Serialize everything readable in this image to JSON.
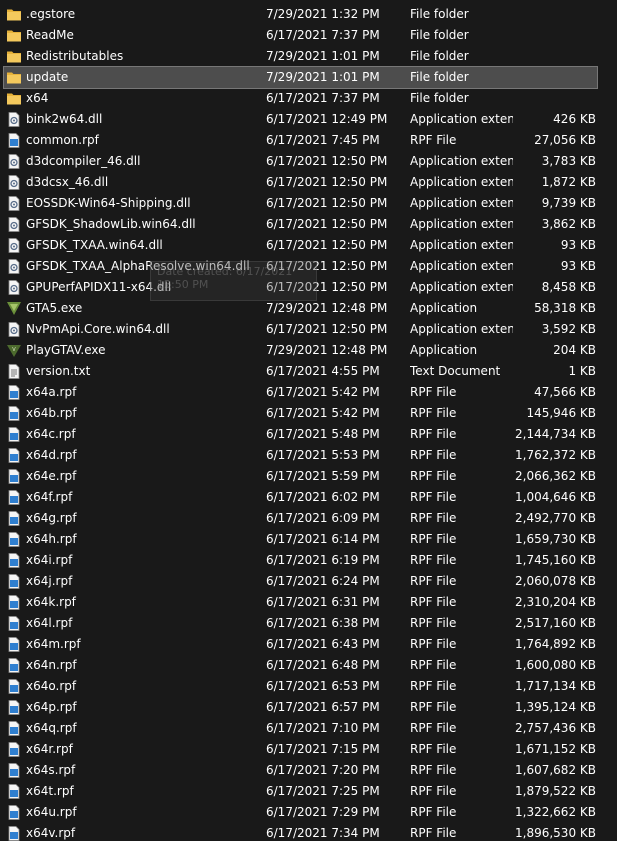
{
  "explorer": {
    "selected_index": 3,
    "files": [
      {
        "name": ".egstore",
        "date": "7/29/2021 1:32 PM",
        "type": "File folder",
        "size": "",
        "icon": "folder-icon"
      },
      {
        "name": "ReadMe",
        "date": "6/17/2021 7:37 PM",
        "type": "File folder",
        "size": "",
        "icon": "folder-icon"
      },
      {
        "name": "Redistributables",
        "date": "7/29/2021 1:01 PM",
        "type": "File folder",
        "size": "",
        "icon": "folder-icon"
      },
      {
        "name": "update",
        "date": "7/29/2021 1:01 PM",
        "type": "File folder",
        "size": "",
        "icon": "folder-icon"
      },
      {
        "name": "x64",
        "date": "6/17/2021 7:37 PM",
        "type": "File folder",
        "size": "",
        "icon": "folder-icon"
      },
      {
        "name": "bink2w64.dll",
        "date": "6/17/2021 12:49 PM",
        "type": "Application exten...",
        "size": "426 KB",
        "icon": "dll-icon"
      },
      {
        "name": "common.rpf",
        "date": "6/17/2021 7:45 PM",
        "type": "RPF File",
        "size": "27,056 KB",
        "icon": "rpf-icon"
      },
      {
        "name": "d3dcompiler_46.dll",
        "date": "6/17/2021 12:50 PM",
        "type": "Application exten...",
        "size": "3,783 KB",
        "icon": "dll-icon"
      },
      {
        "name": "d3dcsx_46.dll",
        "date": "6/17/2021 12:50 PM",
        "type": "Application exten...",
        "size": "1,872 KB",
        "icon": "dll-icon"
      },
      {
        "name": "EOSSDK-Win64-Shipping.dll",
        "date": "6/17/2021 12:50 PM",
        "type": "Application exten...",
        "size": "9,739 KB",
        "icon": "dll-icon"
      },
      {
        "name": "GFSDK_ShadowLib.win64.dll",
        "date": "6/17/2021 12:50 PM",
        "type": "Application exten...",
        "size": "3,862 KB",
        "icon": "dll-icon"
      },
      {
        "name": "GFSDK_TXAA.win64.dll",
        "date": "6/17/2021 12:50 PM",
        "type": "Application exten...",
        "size": "93 KB",
        "icon": "dll-icon"
      },
      {
        "name": "GFSDK_TXAA_AlphaResolve.win64.dll",
        "date": "6/17/2021 12:50 PM",
        "type": "Application exten...",
        "size": "93 KB",
        "icon": "dll-icon"
      },
      {
        "name": "GPUPerfAPIDX11-x64.dll",
        "date": "6/17/2021 12:50 PM",
        "type": "Application exten...",
        "size": "8,458 KB",
        "icon": "dll-icon"
      },
      {
        "name": "GTA5.exe",
        "date": "7/29/2021 12:48 PM",
        "type": "Application",
        "size": "58,318 KB",
        "icon": "gta5-exe-icon"
      },
      {
        "name": "NvPmApi.Core.win64.dll",
        "date": "6/17/2021 12:50 PM",
        "type": "Application exten...",
        "size": "3,592 KB",
        "icon": "dll-icon"
      },
      {
        "name": "PlayGTAV.exe",
        "date": "7/29/2021 12:48 PM",
        "type": "Application",
        "size": "204 KB",
        "icon": "playgtav-exe-icon"
      },
      {
        "name": "version.txt",
        "date": "6/17/2021 4:55 PM",
        "type": "Text Document",
        "size": "1 KB",
        "icon": "txt-icon"
      },
      {
        "name": "x64a.rpf",
        "date": "6/17/2021 5:42 PM",
        "type": "RPF File",
        "size": "47,566 KB",
        "icon": "rpf-icon"
      },
      {
        "name": "x64b.rpf",
        "date": "6/17/2021 5:42 PM",
        "type": "RPF File",
        "size": "145,946 KB",
        "icon": "rpf-icon"
      },
      {
        "name": "x64c.rpf",
        "date": "6/17/2021 5:48 PM",
        "type": "RPF File",
        "size": "2,144,734 KB",
        "icon": "rpf-icon"
      },
      {
        "name": "x64d.rpf",
        "date": "6/17/2021 5:53 PM",
        "type": "RPF File",
        "size": "1,762,372 KB",
        "icon": "rpf-icon"
      },
      {
        "name": "x64e.rpf",
        "date": "6/17/2021 5:59 PM",
        "type": "RPF File",
        "size": "2,066,362 KB",
        "icon": "rpf-icon"
      },
      {
        "name": "x64f.rpf",
        "date": "6/17/2021 6:02 PM",
        "type": "RPF File",
        "size": "1,004,646 KB",
        "icon": "rpf-icon"
      },
      {
        "name": "x64g.rpf",
        "date": "6/17/2021 6:09 PM",
        "type": "RPF File",
        "size": "2,492,770 KB",
        "icon": "rpf-icon"
      },
      {
        "name": "x64h.rpf",
        "date": "6/17/2021 6:14 PM",
        "type": "RPF File",
        "size": "1,659,730 KB",
        "icon": "rpf-icon"
      },
      {
        "name": "x64i.rpf",
        "date": "6/17/2021 6:19 PM",
        "type": "RPF File",
        "size": "1,745,160 KB",
        "icon": "rpf-icon"
      },
      {
        "name": "x64j.rpf",
        "date": "6/17/2021 6:24 PM",
        "type": "RPF File",
        "size": "2,060,078 KB",
        "icon": "rpf-icon"
      },
      {
        "name": "x64k.rpf",
        "date": "6/17/2021 6:31 PM",
        "type": "RPF File",
        "size": "2,310,204 KB",
        "icon": "rpf-icon"
      },
      {
        "name": "x64l.rpf",
        "date": "6/17/2021 6:38 PM",
        "type": "RPF File",
        "size": "2,517,160 KB",
        "icon": "rpf-icon"
      },
      {
        "name": "x64m.rpf",
        "date": "6/17/2021 6:43 PM",
        "type": "RPF File",
        "size": "1,764,892 KB",
        "icon": "rpf-icon"
      },
      {
        "name": "x64n.rpf",
        "date": "6/17/2021 6:48 PM",
        "type": "RPF File",
        "size": "1,600,080 KB",
        "icon": "rpf-icon"
      },
      {
        "name": "x64o.rpf",
        "date": "6/17/2021 6:53 PM",
        "type": "RPF File",
        "size": "1,717,134 KB",
        "icon": "rpf-icon"
      },
      {
        "name": "x64p.rpf",
        "date": "6/17/2021 6:57 PM",
        "type": "RPF File",
        "size": "1,395,124 KB",
        "icon": "rpf-icon"
      },
      {
        "name": "x64q.rpf",
        "date": "6/17/2021 7:10 PM",
        "type": "RPF File",
        "size": "2,757,436 KB",
        "icon": "rpf-icon"
      },
      {
        "name": "x64r.rpf",
        "date": "6/17/2021 7:15 PM",
        "type": "RPF File",
        "size": "1,671,152 KB",
        "icon": "rpf-icon"
      },
      {
        "name": "x64s.rpf",
        "date": "6/17/2021 7:20 PM",
        "type": "RPF File",
        "size": "1,607,682 KB",
        "icon": "rpf-icon"
      },
      {
        "name": "x64t.rpf",
        "date": "6/17/2021 7:25 PM",
        "type": "RPF File",
        "size": "1,879,522 KB",
        "icon": "rpf-icon"
      },
      {
        "name": "x64u.rpf",
        "date": "6/17/2021 7:29 PM",
        "type": "RPF File",
        "size": "1,322,662 KB",
        "icon": "rpf-icon"
      },
      {
        "name": "x64v.rpf",
        "date": "6/17/2021 7:34 PM",
        "type": "RPF File",
        "size": "1,896,530 KB",
        "icon": "rpf-icon"
      }
    ]
  },
  "drag_ghost": {
    "line1": "Date created: 6/17/2021 12:50 PM",
    "line2": "KB"
  },
  "colors": {
    "background": "#191919",
    "text": "#ffffff",
    "selection": "#4d4d4d",
    "folder": "#f2c94c",
    "file_icon": "#3f8fd8"
  }
}
